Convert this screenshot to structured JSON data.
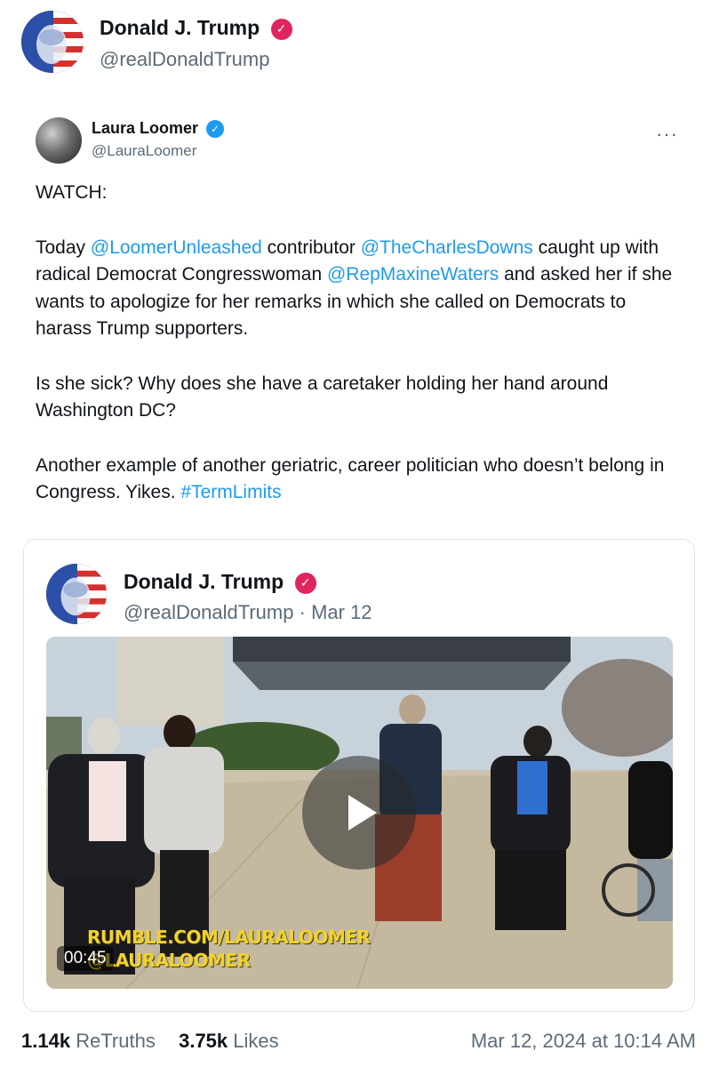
{
  "post": {
    "author_name": "Donald J. Trump",
    "author_handle": "@realDonaldTrump",
    "verified_icon": "verified-check-icon",
    "accent": "#e0245e"
  },
  "embed": {
    "author_name": "Laura Loomer",
    "author_handle": "@LauraLoomer",
    "more_label": "···",
    "verified_color": "#1d9bf0",
    "watch": "WATCH:",
    "p1": {
      "t1": "Today ",
      "m1": "@LoomerUnleashed",
      "t2": " contributor ",
      "m2": "@TheCharlesDowns",
      "t3": " caught up with radical Democrat Congresswoman ",
      "m3": "@RepMaxineWaters",
      "t4": " and asked her if she wants to apologize for her remarks in which she called on Democrats to harass Trump supporters."
    },
    "p2": "Is she sick? Why does she have a caretaker holding her hand around Washington DC?",
    "p3": {
      "t1": "Another example of another geriatric, career politician who doesn’t belong in Congress. Yikes. ",
      "m1": "#TermLimits"
    },
    "link_color": "#1d9bf0"
  },
  "quoted": {
    "author_name": "Donald J. Trump",
    "author_handle": "@realDonaldTrump",
    "separator": "·",
    "date": "Mar 12",
    "video": {
      "watermark_line1": "RUMBLE.COM/LAURALOOMER",
      "watermark_line2": "@LAURALOOMER",
      "duration": "00:45",
      "play_icon": "play-icon"
    }
  },
  "footer": {
    "retruths_count": "1.14k",
    "retruths_label": "ReTruths",
    "likes_count": "3.75k",
    "likes_label": "Likes",
    "timestamp": "Mar 12, 2024 at 10:14 AM"
  }
}
